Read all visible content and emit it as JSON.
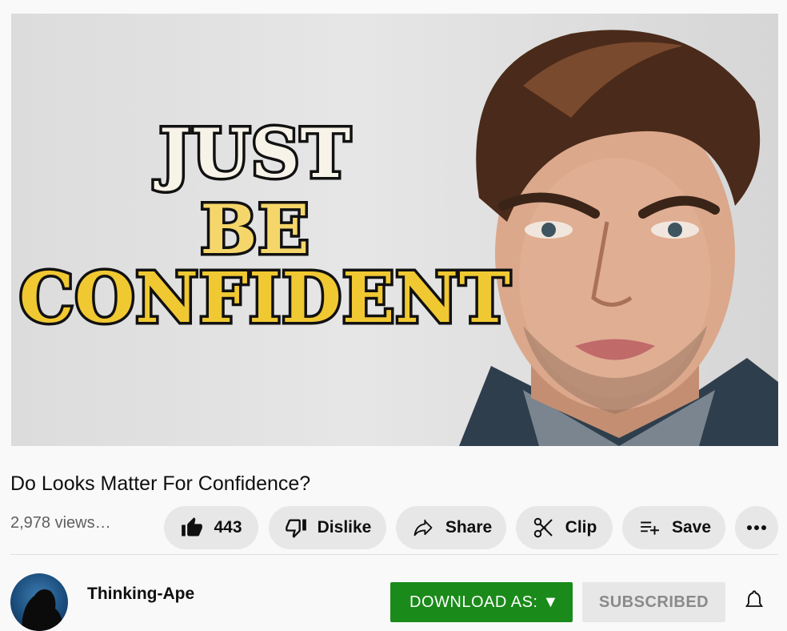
{
  "video": {
    "thumbnail_text": [
      "JUST",
      "BE",
      "CONFIDENT"
    ]
  },
  "title": "Do Looks Matter For Confidence?",
  "views": "2,978 views…",
  "actions": {
    "like_count": "443",
    "dislike_label": "Dislike",
    "share_label": "Share",
    "clip_label": "Clip",
    "save_label": "Save"
  },
  "channel": {
    "name": "Thinking-Ape",
    "download_label": "DOWNLOAD AS: ▼",
    "subscribed_label": "SUBSCRIBED"
  },
  "icons": {
    "like": "thumbs-up-icon",
    "dislike": "thumbs-down-icon",
    "share": "share-arrow-icon",
    "clip": "scissors-icon",
    "save": "playlist-add-icon",
    "more": "more-horizontal-icon",
    "bell": "bell-icon"
  },
  "colors": {
    "download_button": "#1a8a1a",
    "pill_background": "#e7e7e7",
    "subscribed_text": "#8a8a8a"
  }
}
